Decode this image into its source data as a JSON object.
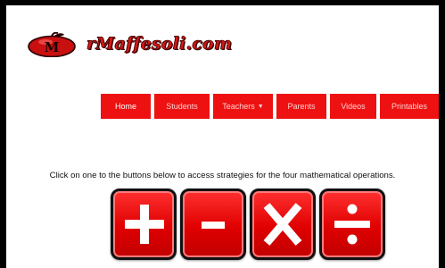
{
  "brand": {
    "logo_text": "rMaffesoli.com",
    "logo_mark_icon": "apple-logo-icon",
    "brand_color": "#d41616"
  },
  "nav": {
    "items": [
      {
        "label": "Home"
      },
      {
        "label": "Students"
      },
      {
        "label": "Teachers"
      },
      {
        "label": "Parents"
      },
      {
        "label": "Videos"
      },
      {
        "label": "Printables"
      }
    ],
    "teachers_caret_icon": "caret-down-icon",
    "bg_color": "#ee1111"
  },
  "instruction": {
    "text": "Click on one to the buttons below to access strategies for the four mathematical operations."
  },
  "operations": [
    {
      "icon": "plus-icon",
      "operation": "addition"
    },
    {
      "icon": "minus-icon",
      "operation": "subtraction"
    },
    {
      "icon": "multiply-icon",
      "operation": "multiplication"
    },
    {
      "icon": "divide-icon",
      "operation": "division"
    }
  ]
}
